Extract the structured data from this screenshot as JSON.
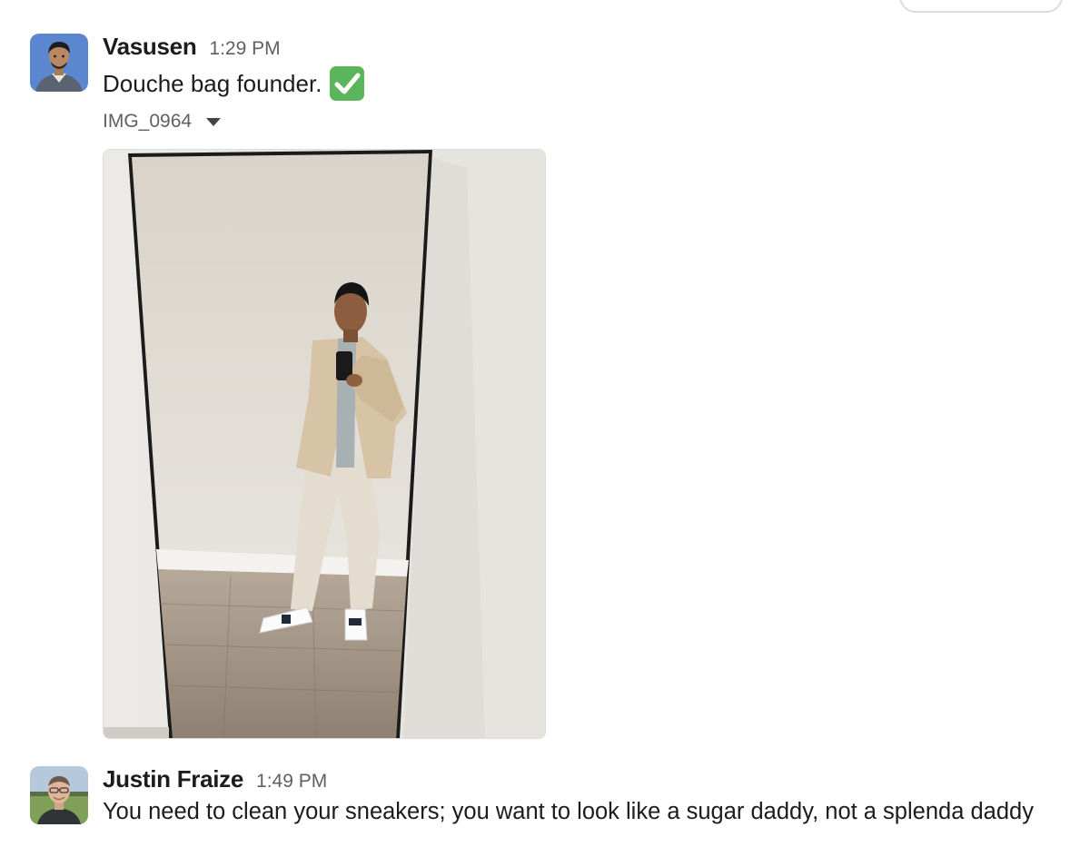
{
  "messages": [
    {
      "sender": "Vasusen",
      "time": "1:29 PM",
      "text": "Douche bag founder.",
      "emoji": "white-check-mark",
      "attachment": {
        "name": "IMG_0964"
      }
    },
    {
      "sender": "Justin Fraize",
      "time": "1:49 PM",
      "text": "You need to clean your sneakers; you want to look like a sugar daddy, not a splenda daddy"
    }
  ],
  "colors": {
    "text": "#1d1c1d",
    "muted": "#616061",
    "emoji_green": "#5bb65b"
  }
}
